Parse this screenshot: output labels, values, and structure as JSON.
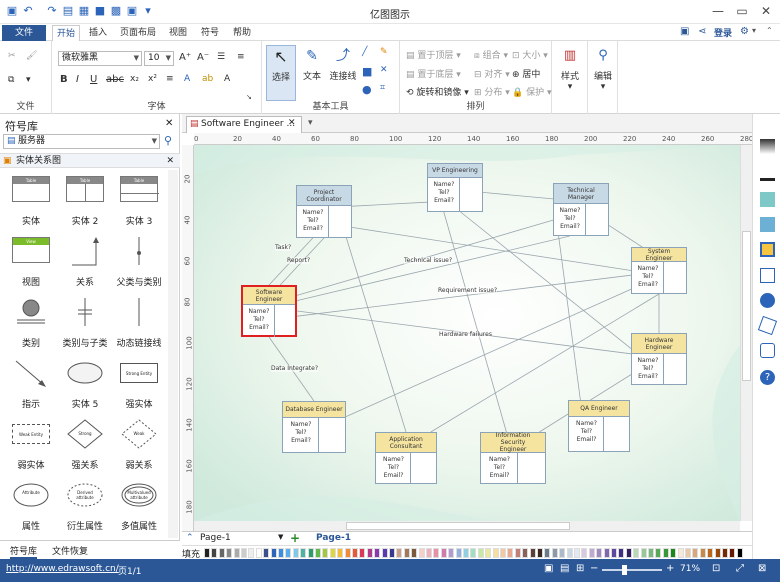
{
  "app": {
    "title": "亿图图示"
  },
  "menu": {
    "file": "文件",
    "tabs": [
      "开始",
      "插入",
      "页面布局",
      "视图",
      "符号",
      "帮助"
    ],
    "login": "登录"
  },
  "ribbon": {
    "file_group": {
      "label": "文件"
    },
    "font_group": {
      "label": "字体",
      "font_name": "微软雅黑",
      "font_size": "10"
    },
    "tools_group": {
      "label": "基本工具",
      "select": "选择",
      "text": "文本",
      "connector": "连接线"
    },
    "arrange_group": {
      "label": "排列",
      "bring_front": "置于顶层",
      "send_back": "置于底层",
      "rotate_mirror": "旋转和镜像",
      "group": "组合",
      "align": "对齐",
      "distribute": "分布",
      "size": "大小",
      "center": "居中",
      "protect": "保护"
    },
    "style_group": {
      "label": "样式"
    },
    "edit_group": {
      "label": "编辑"
    }
  },
  "sidebar": {
    "title": "符号库",
    "search_value": "服务器",
    "library": "实体关系图",
    "shapes": [
      {
        "label": "实体",
        "thumb": "Table"
      },
      {
        "label": "实体 2",
        "thumb": "Table"
      },
      {
        "label": "实体 3",
        "thumb": "Table"
      },
      {
        "label": "视图",
        "thumb": "View"
      },
      {
        "label": "关系",
        "thumb": ""
      },
      {
        "label": "父类与类别",
        "thumb": ""
      },
      {
        "label": "类别",
        "thumb": ""
      },
      {
        "label": "类别与子类",
        "thumb": ""
      },
      {
        "label": "动态链接线",
        "thumb": ""
      },
      {
        "label": "指示",
        "thumb": ""
      },
      {
        "label": "实体 5",
        "thumb": ""
      },
      {
        "label": "强实体",
        "thumb": "Strong Entity"
      },
      {
        "label": "弱实体",
        "thumb": "Weak Entity"
      },
      {
        "label": "强关系",
        "thumb": "Strong"
      },
      {
        "label": "弱关系",
        "thumb": "Weak"
      },
      {
        "label": "属性",
        "thumb": "Attribute"
      },
      {
        "label": "衍生属性",
        "thumb": "Derived attribute"
      },
      {
        "label": "多值属性",
        "thumb": "Multivalued attribute"
      }
    ],
    "tabs": [
      "符号库",
      "文件恢复"
    ]
  },
  "document": {
    "tab_title": "Software Engineer ..."
  },
  "rulers": {
    "h": [
      "0",
      "20",
      "40",
      "60",
      "80",
      "100",
      "120",
      "140",
      "160",
      "180",
      "200",
      "220",
      "240",
      "260",
      "280"
    ],
    "v": [
      "20",
      "40",
      "60",
      "80",
      "100",
      "120",
      "140",
      "160",
      "180"
    ]
  },
  "diagram": {
    "fields": "Name?\nTel?\nEmail?",
    "entities": [
      {
        "id": "pc",
        "title": "Project\nCoordinator"
      },
      {
        "id": "vp",
        "title": "VP Engineering"
      },
      {
        "id": "tm",
        "title": "Technical\nManager"
      },
      {
        "id": "se",
        "title": "Software Engineer"
      },
      {
        "id": "sys",
        "title": "System Engineer"
      },
      {
        "id": "hw",
        "title": "Hardware\nEngineer"
      },
      {
        "id": "db",
        "title": "Database Engineer"
      },
      {
        "id": "qa",
        "title": "QA Engineer"
      },
      {
        "id": "ac",
        "title": "Application\nConsultant"
      },
      {
        "id": "ise",
        "title": "Information Security\nEngineer"
      }
    ],
    "labels": [
      "Task?",
      "Report?",
      "Technical issue?",
      "Requirement issue?",
      "Hardware failures",
      "Data Integrate?"
    ]
  },
  "pagebar": {
    "page_tab": "Page-1",
    "page_active": "Page-1"
  },
  "colorbar": {
    "label": "填充"
  },
  "status": {
    "url": "http://www.edrawsoft.cn/",
    "page": "页1/1",
    "zoom": "71%"
  },
  "colors": {
    "accent": "#2b5797",
    "selected": "#e02020",
    "entity_header_blue": "#c8d9e6",
    "entity_header_yellow": "#f5e4a0"
  }
}
